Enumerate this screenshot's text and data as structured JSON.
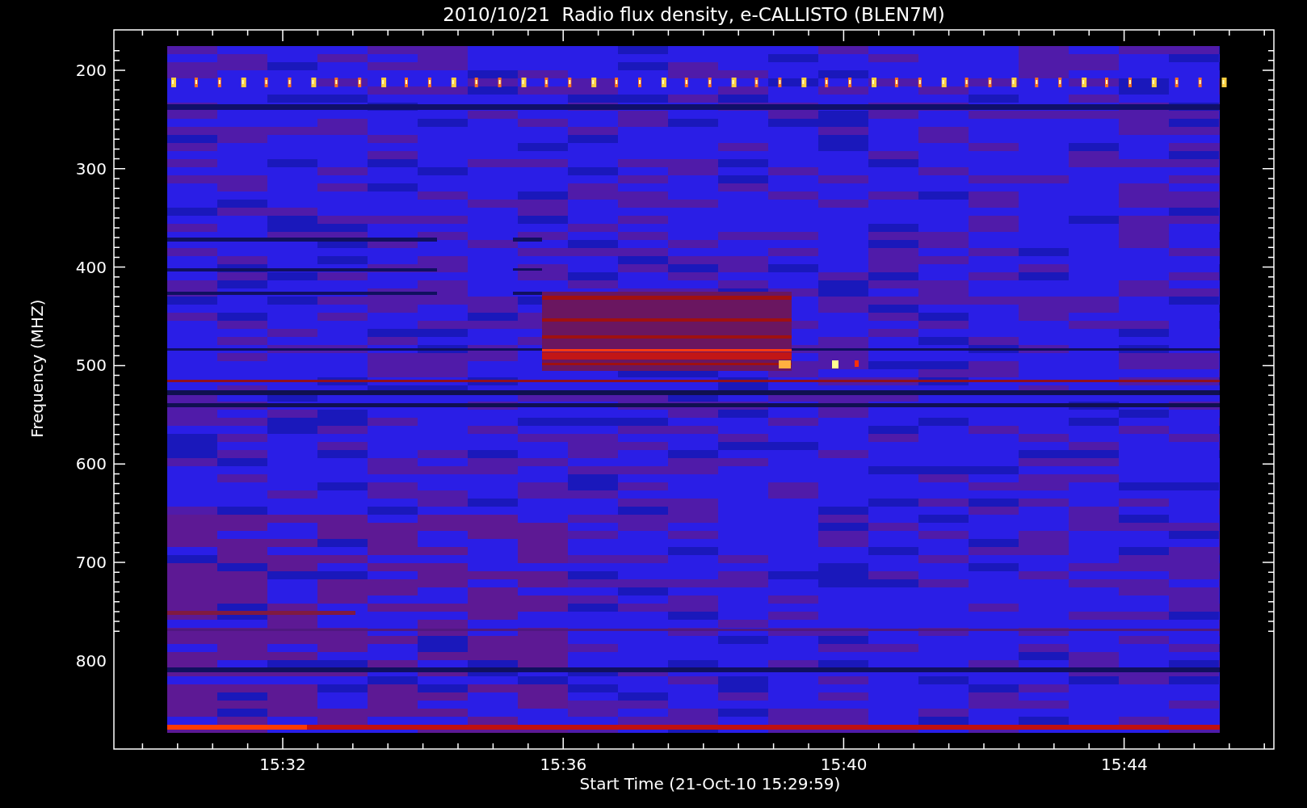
{
  "title": "2010/10/21  Radio flux density, e-CALLISTO (BLEN7M)",
  "y_axis": {
    "label": "Frequency (MHZ)",
    "ticks": [
      "200",
      "300",
      "400",
      "500",
      "600",
      "700",
      "800"
    ]
  },
  "x_axis": {
    "label": "Start Time (21-Oct-10 15:29:59)",
    "ticks": [
      "15:32",
      "15:36",
      "15:40",
      "15:44"
    ]
  }
}
